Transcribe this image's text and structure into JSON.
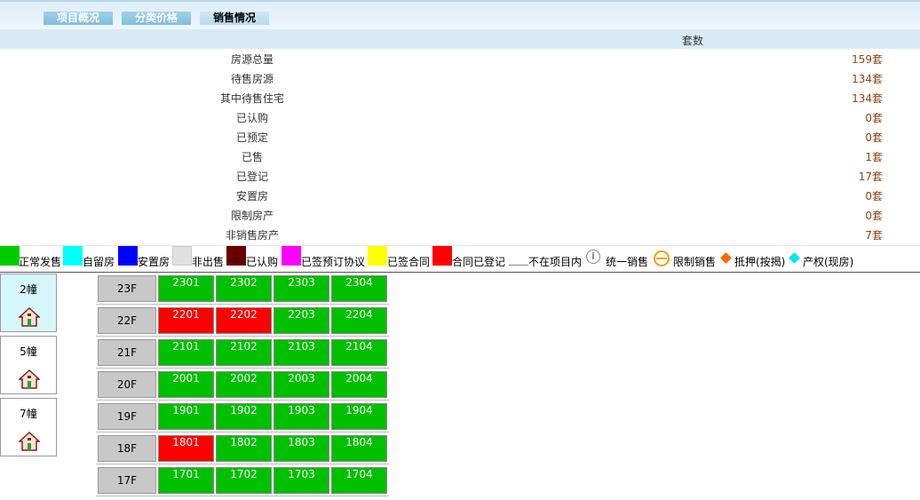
{
  "tabs": [
    {
      "label": "项目概况"
    },
    {
      "label": "分类价格"
    },
    {
      "label": "销售情况"
    }
  ],
  "header": {
    "column_label": "套数"
  },
  "stats": [
    {
      "label": "房源总量",
      "value": "159套"
    },
    {
      "label": "待售房源",
      "value": "134套"
    },
    {
      "label": "其中待售住宅",
      "value": "134套"
    },
    {
      "label": "已认购",
      "value": "0套"
    },
    {
      "label": "已预定",
      "value": "0套"
    },
    {
      "label": "已售",
      "value": "1套"
    },
    {
      "label": "已登记",
      "value": "17套"
    },
    {
      "label": "安置房",
      "value": "0套"
    },
    {
      "label": "限制房产",
      "value": "0套"
    },
    {
      "label": "非销售房产",
      "value": "7套"
    }
  ],
  "legend": [
    {
      "label": "正常发售",
      "color": "#00cc00"
    },
    {
      "label": "自留房",
      "color": "#00ffff"
    },
    {
      "label": "安置房",
      "color": "#0000ff"
    },
    {
      "label": "非出售",
      "color": "#e0e0e0"
    },
    {
      "label": "已认购",
      "color": "#660000"
    },
    {
      "label": "已签预订协议",
      "color": "#ff00ff"
    },
    {
      "label": "已签合同",
      "color": "#ffff00"
    },
    {
      "label": "合同已登记",
      "color": "#ff0000"
    },
    {
      "label": "不在项目内",
      "color": "#ffffff"
    },
    {
      "label": "统一销售",
      "icon": "info-circle-icon"
    },
    {
      "label": "限制销售",
      "icon": "restricted-circle-icon"
    },
    {
      "label": "抵押(按揭)",
      "icon": "orange-diamond-icon",
      "color": "#ff6600"
    },
    {
      "label": "产权(现房)",
      "icon": "cyan-diamond-icon",
      "color": "#00e5ee"
    }
  ],
  "buildings": [
    {
      "name": "2幢",
      "selected": true
    },
    {
      "name": "5幢",
      "selected": false
    },
    {
      "name": "7幢",
      "selected": false
    }
  ],
  "colors": {
    "on_sale": "#00c000",
    "registered": "#ff0000"
  },
  "floors": [
    {
      "label": "23F",
      "units": [
        {
          "no": "2301",
          "status": "on_sale"
        },
        {
          "no": "2302",
          "status": "on_sale"
        },
        {
          "no": "2303",
          "status": "on_sale"
        },
        {
          "no": "2304",
          "status": "on_sale"
        }
      ]
    },
    {
      "label": "22F",
      "units": [
        {
          "no": "2201",
          "status": "registered"
        },
        {
          "no": "2202",
          "status": "registered"
        },
        {
          "no": "2203",
          "status": "on_sale"
        },
        {
          "no": "2204",
          "status": "on_sale"
        }
      ]
    },
    {
      "label": "21F",
      "units": [
        {
          "no": "2101",
          "status": "on_sale"
        },
        {
          "no": "2102",
          "status": "on_sale"
        },
        {
          "no": "2103",
          "status": "on_sale"
        },
        {
          "no": "2104",
          "status": "on_sale"
        }
      ]
    },
    {
      "label": "20F",
      "units": [
        {
          "no": "2001",
          "status": "on_sale"
        },
        {
          "no": "2002",
          "status": "on_sale"
        },
        {
          "no": "2003",
          "status": "on_sale"
        },
        {
          "no": "2004",
          "status": "on_sale"
        }
      ]
    },
    {
      "label": "19F",
      "units": [
        {
          "no": "1901",
          "status": "on_sale"
        },
        {
          "no": "1902",
          "status": "on_sale"
        },
        {
          "no": "1903",
          "status": "on_sale"
        },
        {
          "no": "1904",
          "status": "on_sale"
        }
      ]
    },
    {
      "label": "18F",
      "units": [
        {
          "no": "1801",
          "status": "registered"
        },
        {
          "no": "1802",
          "status": "on_sale"
        },
        {
          "no": "1803",
          "status": "on_sale"
        },
        {
          "no": "1804",
          "status": "on_sale"
        }
      ]
    },
    {
      "label": "17F",
      "units": [
        {
          "no": "1701",
          "status": "on_sale"
        },
        {
          "no": "1702",
          "status": "on_sale"
        },
        {
          "no": "1703",
          "status": "on_sale"
        },
        {
          "no": "1704",
          "status": "on_sale"
        }
      ]
    }
  ]
}
